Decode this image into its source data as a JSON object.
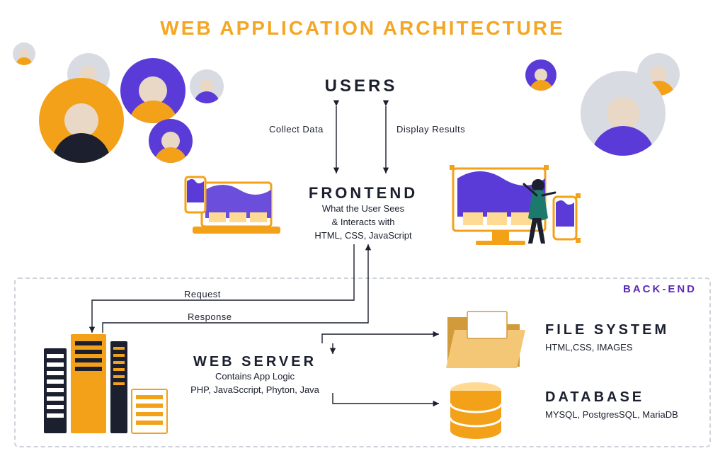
{
  "title": "WEB APPLICATION ARCHITECTURE",
  "sections": {
    "users": {
      "label": "USERS"
    },
    "frontend": {
      "label": "FRONTEND",
      "desc_line1": "What the User Sees",
      "desc_line2": "& Interacts with",
      "desc_line3": "HTML, CSS, JavaScript"
    },
    "webserver": {
      "label": "WEB SERVER",
      "desc_line1": "Contains App Logic",
      "desc_line2": "PHP, JavaSccript, Phyton, Java"
    },
    "filesystem": {
      "label": "FILE SYSTEM",
      "desc": "HTML,CSS, IMAGES"
    },
    "database": {
      "label": "DATABASE",
      "desc": "MYSQL, PostgresSQL, MariaDB"
    }
  },
  "arrows": {
    "collect_data": "Collect Data",
    "display_results": "Display Results",
    "request": "Request",
    "response": "Response"
  },
  "backend_label": "BACK-END",
  "colors": {
    "accent_orange": "#f5a623",
    "accent_purple": "#5b3bd8",
    "text": "#1b1f2e"
  }
}
